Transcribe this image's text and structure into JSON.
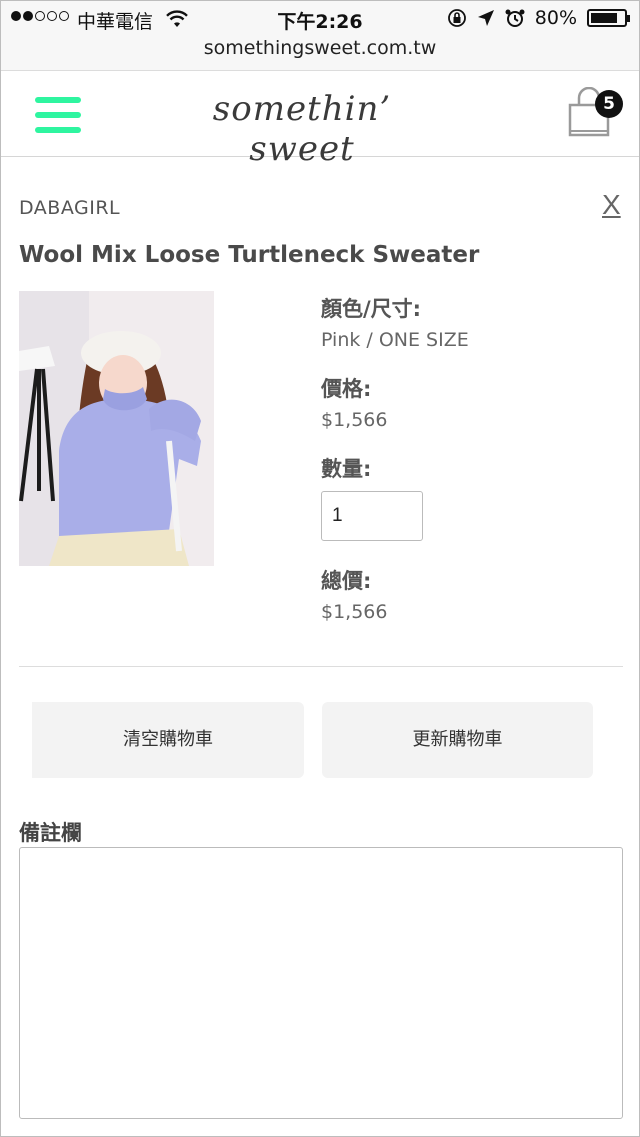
{
  "status_bar": {
    "carrier": "中華電信",
    "time": "下午2:26",
    "battery": "80%",
    "battery_level": 0.8
  },
  "browser": {
    "url": "somethingsweet.com.tw"
  },
  "header": {
    "logo": "somethin’ sweet",
    "cart_count": "5",
    "accent_color": "#2ef5a0"
  },
  "item": {
    "brand": "DABAGIRL",
    "close": "X",
    "title": "Wool Mix Loose Turtleneck Sweater",
    "color_size_label": "顏色/尺寸:",
    "color_size_value": "Pink / ONE SIZE",
    "price_label": "價格:",
    "price_value": "$1,566",
    "quantity_label": "數量:",
    "quantity_value": "1",
    "total_label": "總價:",
    "total_value": "$1,566"
  },
  "actions": {
    "clear_cart": "清空購物車",
    "update_cart": "更新購物車"
  },
  "remarks": {
    "label": "備註欄",
    "value": ""
  }
}
